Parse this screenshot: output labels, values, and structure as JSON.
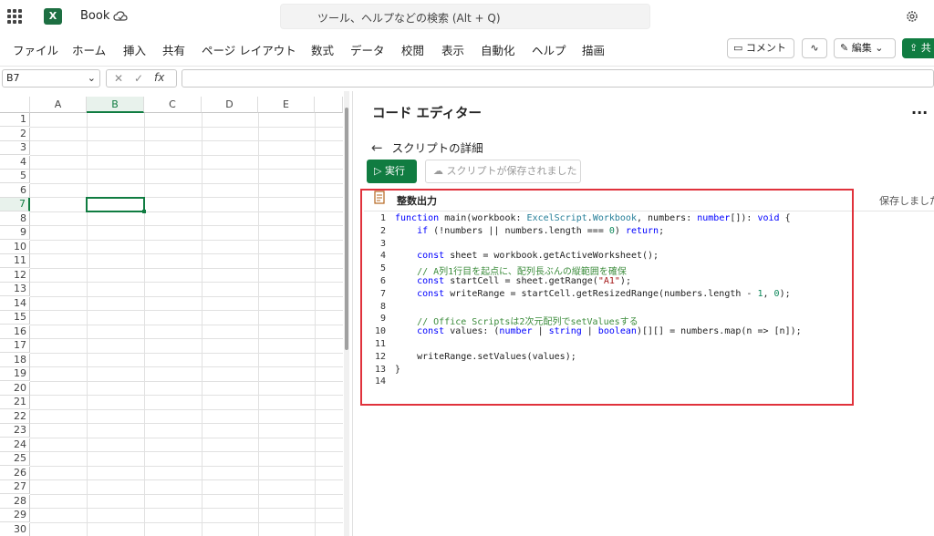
{
  "titlebar": {
    "app": "X",
    "title": "Book",
    "search_placeholder": "ツール、ヘルプなどの検索 (Alt + Q)"
  },
  "ribbon": {
    "tabs": [
      "ファイル",
      "ホーム",
      "挿入",
      "共有",
      "ページ レイアウト",
      "数式",
      "データ",
      "校閲",
      "表示",
      "自動化",
      "ヘルプ",
      "描画"
    ],
    "comment": "コメント",
    "edit": "編集",
    "share": "共"
  },
  "formula_bar": {
    "namebox": "B7",
    "fx": "fx",
    "formula": ""
  },
  "grid": {
    "columns": [
      "A",
      "B",
      "C",
      "D",
      "E"
    ],
    "rows": [
      "1",
      "2",
      "3",
      "4",
      "5",
      "6",
      "7",
      "8",
      "9",
      "10",
      "11",
      "12",
      "13",
      "14",
      "15",
      "16",
      "17",
      "18",
      "19",
      "20",
      "21",
      "22",
      "23",
      "24",
      "25",
      "26",
      "27",
      "28",
      "29",
      "30"
    ],
    "selected_col": "B",
    "selected_row": "7"
  },
  "pane": {
    "title": "コード エディター",
    "more": "...",
    "back_label": "スクリプトの詳細",
    "run": "実行",
    "saved_btn": "スクリプトが保存されました",
    "script_name": "整数出力",
    "save_state": "保存しました",
    "line_numbers": [
      "1",
      "2",
      "3",
      "4",
      "5",
      "6",
      "7",
      "8",
      "9",
      "10",
      "11",
      "12",
      "13",
      "14"
    ],
    "code_lines": [
      "function main(workbook: ExcelScript.Workbook, numbers: number[]): void {",
      "    if (!numbers || numbers.length === 0) return;",
      "",
      "    const sheet = workbook.getActiveWorksheet();",
      "    // A列1行目を起点に、配列長ぶんの縦範囲を確保",
      "    const startCell = sheet.getRange(\"A1\");",
      "    const writeRange = startCell.getResizedRange(numbers.length - 1, 0);",
      "",
      "    // Office Scriptsは2次元配列でsetValuesする",
      "    const values: (number | string | boolean)[][] = numbers.map(n => [n]);",
      "",
      "    writeRange.setValues(values);",
      "}",
      ""
    ]
  },
  "colors": {
    "accent": "#107c41",
    "highlight": "#e0323c",
    "keyword": "#0000ff",
    "type": "#267f99",
    "comment": "#3c8c3c"
  }
}
